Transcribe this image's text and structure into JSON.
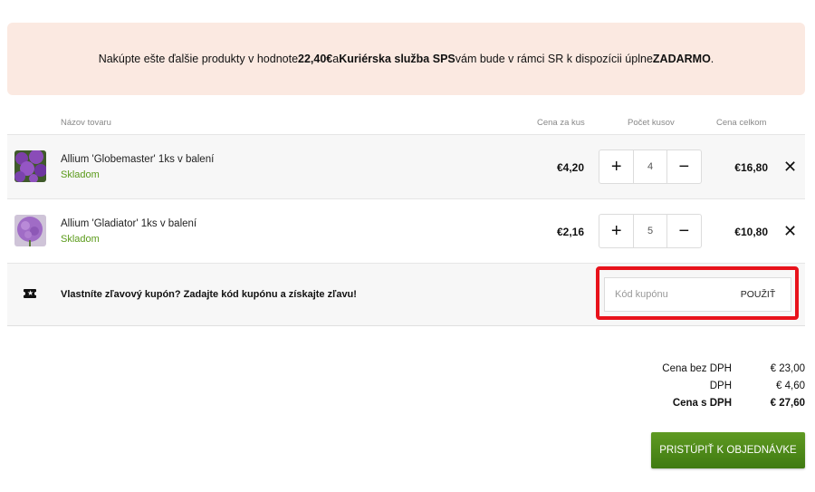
{
  "banner": {
    "part1": "Nakúpte ešte ďalšie produkty v hodnote ",
    "amount": "22,40€",
    "part2": " a ",
    "service": "Kuriérska služba SPS",
    "part3": " vám bude v rámci SR k dispozícii úplne ",
    "free": "ZADARMO",
    "part4": "."
  },
  "table": {
    "headers": {
      "name": "Názov tovaru",
      "unit_price": "Cena za kus",
      "quantity": "Počet kusov",
      "total": "Cena celkom"
    },
    "items": [
      {
        "name": "Allium 'Globemaster' 1ks v balení",
        "stock": "Skladom",
        "unit_price": "€4,20",
        "quantity": "4",
        "total": "€16,80"
      },
      {
        "name": "Allium 'Gladiator' 1ks v balení",
        "stock": "Skladom",
        "unit_price": "€2,16",
        "quantity": "5",
        "total": "€10,80"
      }
    ]
  },
  "coupon": {
    "text": "Vlastníte zľavový kupón? Zadajte kód kupónu a získajte zľavu!",
    "placeholder": "Kód kupónu",
    "value": "",
    "apply_label": "POUŽIŤ"
  },
  "summary": {
    "rows": [
      {
        "label": "Cena bez DPH",
        "value": "€ 23,00"
      },
      {
        "label": "DPH",
        "value": "€ 4,60"
      },
      {
        "label": "Cena s DPH",
        "value": "€ 27,60"
      }
    ]
  },
  "checkout_label": "PRISTÚPIŤ K OBJEDNÁVKE",
  "icons": {
    "plus": "+",
    "minus": "−",
    "remove": "✕",
    "coupon": "ticket-icon"
  },
  "colors": {
    "banner_bg": "#fbe9e1",
    "stock_green": "#5a9a19",
    "highlight_red": "#e8121b",
    "checkout_green": "#4f8a1a"
  }
}
